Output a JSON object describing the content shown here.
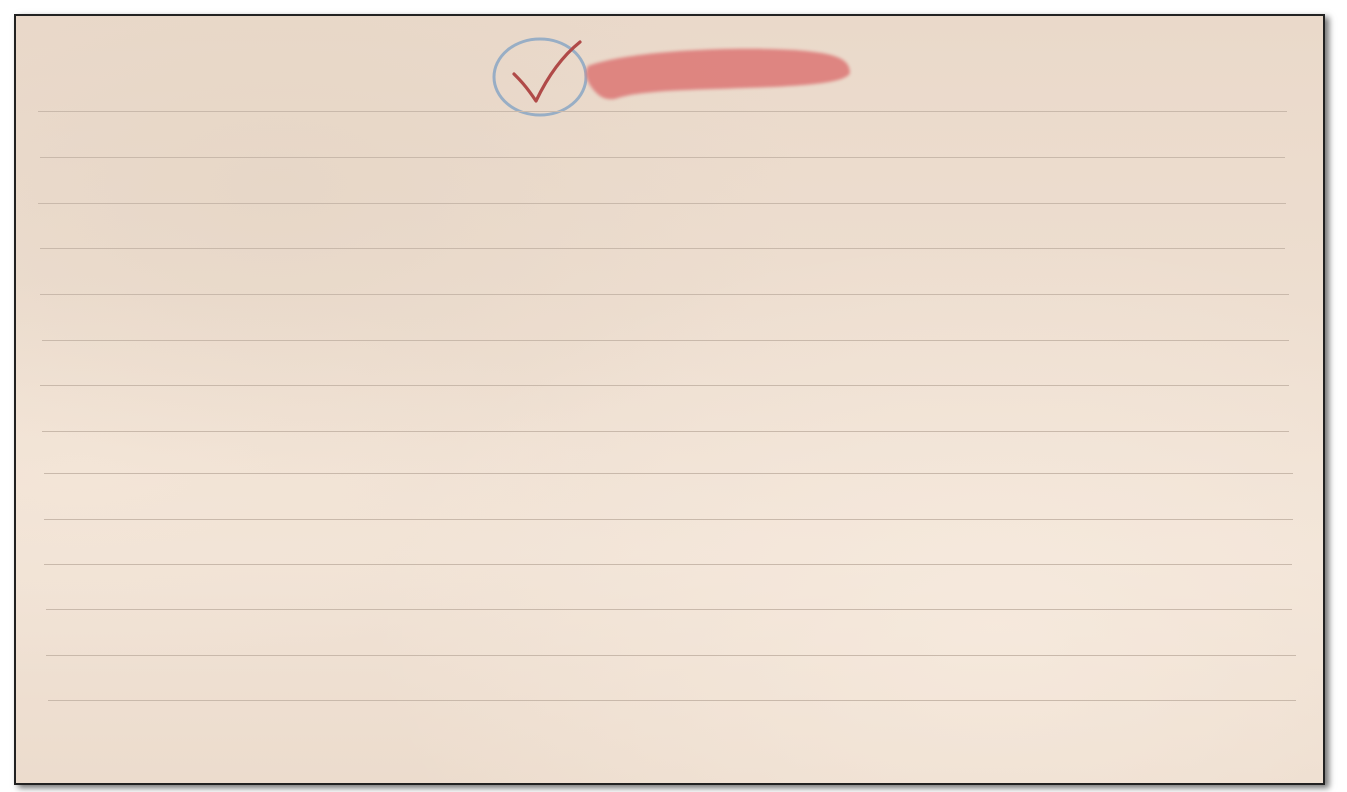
{
  "card": {
    "colors": {
      "paper": "#eedfd1",
      "rule_line": "#c9b9ab",
      "border": "#222222"
    }
  },
  "check_badge": {
    "icon": "circled-checkmark-icon",
    "checked": true,
    "colors": {
      "circle": "#8fa8c4",
      "check": "#b04a48"
    }
  },
  "title_highlight": {
    "text": "",
    "color": "#dd7b79"
  }
}
